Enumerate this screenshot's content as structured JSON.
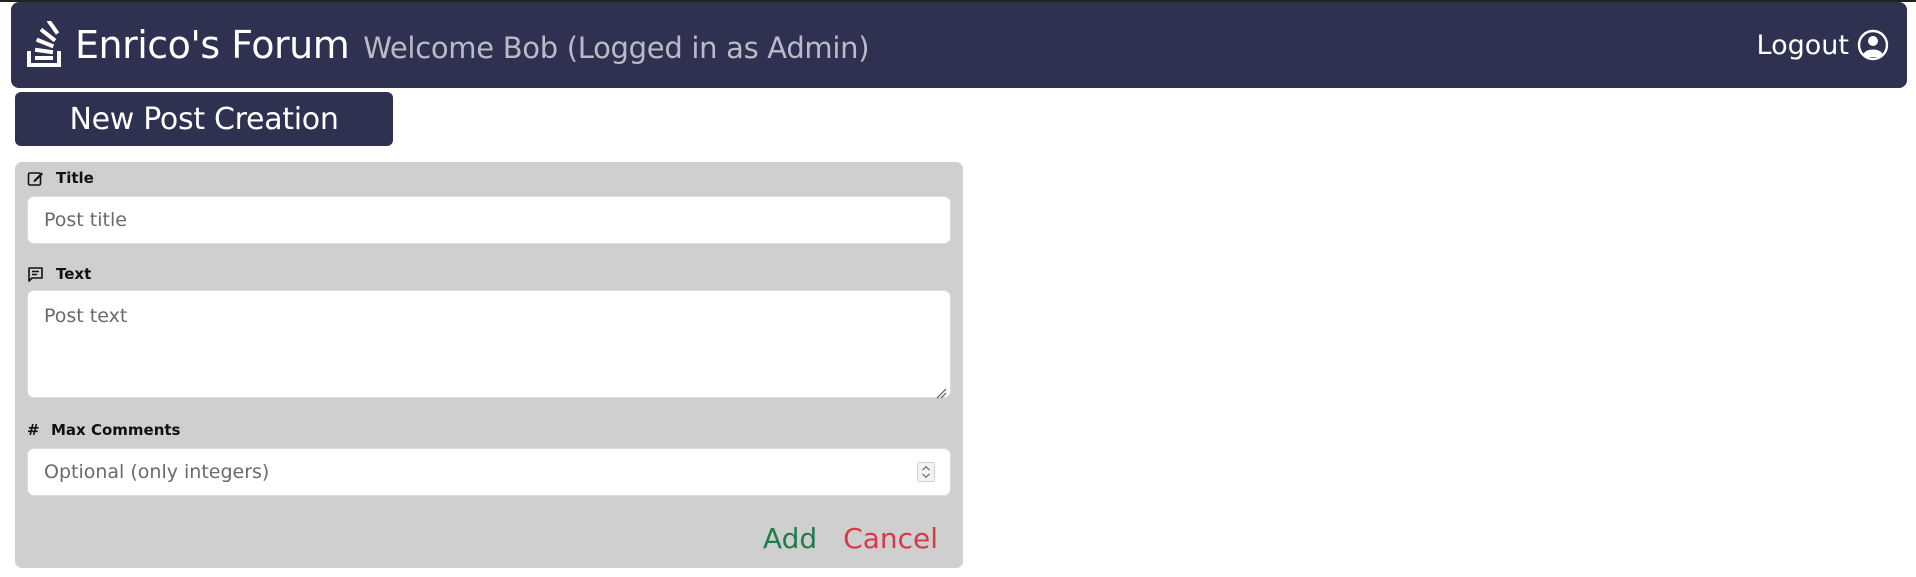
{
  "header": {
    "app_name": "Enrico's Forum",
    "welcome_text": "Welcome Bob (Logged in as Admin)",
    "logout_label": "Logout"
  },
  "page": {
    "section_title": "New Post Creation"
  },
  "form": {
    "title_label": "Title",
    "title_placeholder": "Post title",
    "text_label": "Text",
    "text_placeholder": "Post text",
    "max_comments_label": "Max Comments",
    "max_comments_symbol": "#",
    "max_comments_placeholder": "Optional (only integers)",
    "add_label": "Add",
    "cancel_label": "Cancel"
  },
  "colors": {
    "navbar_bg": "#2e3150",
    "form_bg": "#cfcfcf",
    "add": "#1e7d4b",
    "cancel": "#d43a47"
  },
  "icons": {
    "brand": "stack-overflow-icon",
    "logout": "user-circle-icon",
    "title": "pencil-square-icon",
    "text": "chat-left-text-icon"
  }
}
